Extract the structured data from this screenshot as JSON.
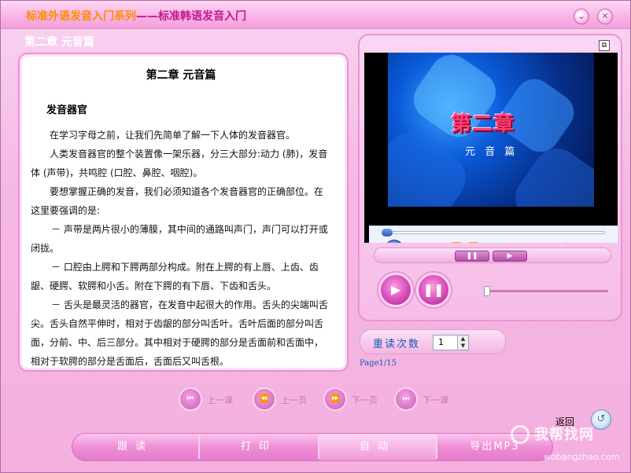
{
  "window": {
    "title_prefix": "标准外语发音入门系列",
    "title_suffix": "——标准韩语发音入门",
    "minimize_icon": "chevron-down-icon",
    "close_icon": "close-icon"
  },
  "chapter_header": "第二章  元音篇",
  "document": {
    "title": "第二章   元音篇",
    "heading": "发音器官",
    "paragraphs": [
      "在学习字母之前，让我们先简单了解一下人体的发音器官。",
      "人类发音器官的整个装置像一架乐器，分三大部分:动力 (肺)，发音体 (声带)，共鸣腔 (口腔、鼻腔、咽腔)。",
      "要想掌握正确的发音，我们必须知道各个发音器官的正确部位。在这里要强调的是:",
      "－ 声带是两片很小的薄膜，其中间的通路叫声门，声门可以打开或闭拢。",
      "－ 口腔由上腭和下腭两部分构成。附在上腭的有上唇、上齿、齿龈、硬腭、软腭和小舌。附在下腭的有下唇、下齿和舌头。",
      "－ 舌头是最灵活的器官，在发音中起很大的作用。舌头的尖端叫舌尖。舌头自然平伸时，相对于齿龈的部分叫舌叶。舌叶后面的部分叫舌面，分前、中、后三部分。其中相对于硬腭的部分是舌面前和舌面中，相对于软腭的部分是舌面后，舌面后又叫舌根。"
    ]
  },
  "video": {
    "title_text": "第二章",
    "subtitle_text": "元 音 篇",
    "restore_icon": "restore-window-icon",
    "player": {
      "pause_icon": "pause-icon",
      "stop_icon": "stop-icon",
      "prev_icon": "skip-back-icon",
      "rewind_icon": "rewind-icon",
      "forward_icon": "fast-forward-icon",
      "next_icon": "skip-forward-icon",
      "volume_icon": "volume-icon"
    },
    "strip_pause_label": "❚❚",
    "strip_play_label": "▶"
  },
  "reread": {
    "label": "重读次数",
    "value": "1"
  },
  "page_info": "Page1/15",
  "nav": {
    "prev_lesson": "上一课",
    "prev_page": "上一页",
    "next_page": "下一页",
    "next_lesson": "下一课"
  },
  "return_label": "返回",
  "bottom_bar": {
    "follow": "跟读",
    "print": "打印",
    "auto": "自动",
    "export": "导出MP3"
  },
  "watermark": {
    "text": "我帮找网",
    "url": "wobangzhao.com"
  },
  "colors": {
    "title_orange": "#ff8c00",
    "title_magenta": "#c2188a",
    "accent_blue": "#1a58b8",
    "pink_bg": "#f5b8e4"
  }
}
